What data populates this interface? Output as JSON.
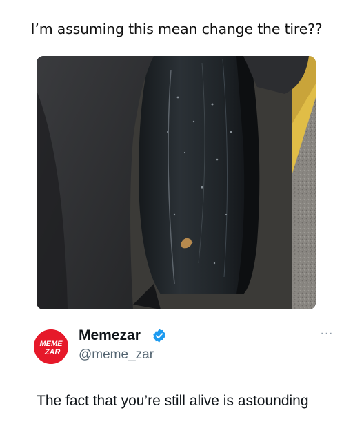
{
  "meme": {
    "caption": "I’m assuming this mean change the tire??"
  },
  "photo": {
    "subject": "bald-tire-photo"
  },
  "post": {
    "display_name": "Memezar",
    "handle": "@meme_zar",
    "avatar_text_line1": "MEME",
    "avatar_text_line2": "ZAR",
    "verified": true,
    "more_label": "···",
    "text": "The fact that you’re still alive is astounding"
  },
  "colors": {
    "avatar_bg": "#e6192a",
    "verified_blue": "#1d9bf0",
    "handle_gray": "#536471"
  }
}
